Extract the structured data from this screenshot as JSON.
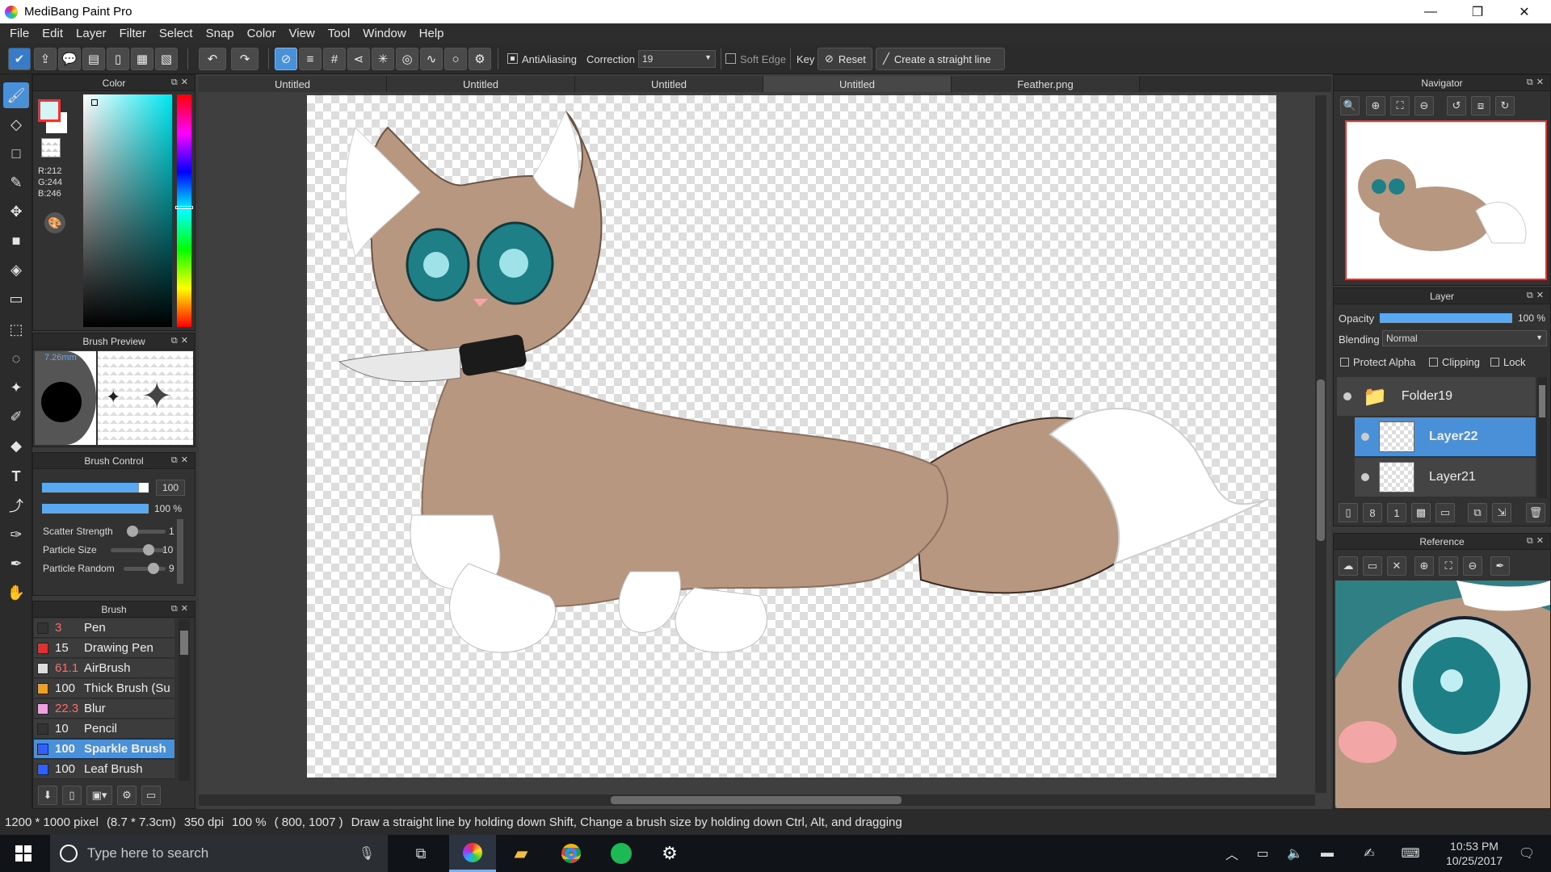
{
  "window": {
    "title": "MediBang Paint Pro",
    "controls": [
      "—",
      "❐",
      "✕"
    ]
  },
  "menu": [
    "File",
    "Edit",
    "Layer",
    "Filter",
    "Select",
    "Snap",
    "Color",
    "View",
    "Tool",
    "Window",
    "Help"
  ],
  "toolbar": {
    "antialiasing_label": "AntiAliasing",
    "correction_label": "Correction",
    "correction_value": "19",
    "softedge_label": "Soft Edge",
    "key_label": "Key",
    "reset_label": "Reset",
    "straight_line_label": "Create a straight line"
  },
  "color_panel": {
    "title": "Color",
    "r": "R:212",
    "g": "G:244",
    "b": "B:246",
    "fg_color": "#d4f4f6"
  },
  "brush_preview": {
    "title": "Brush Preview",
    "size_label": "7.26mm"
  },
  "brush_control": {
    "title": "Brush Control",
    "size_value": "100",
    "opacity_value": "100 %",
    "scatter_label": "Scatter Strength",
    "scatter_value": "1",
    "particle_size_label": "Particle Size",
    "particle_size_value": "10",
    "particle_random_label": "Particle Random",
    "particle_random_value": "9"
  },
  "brush_panel": {
    "title": "Brush",
    "items": [
      {
        "size": "3",
        "name": "Pen",
        "color": "#333333",
        "red": true
      },
      {
        "size": "15",
        "name": "Drawing Pen",
        "color": "#e53030",
        "red": false
      },
      {
        "size": "61.1",
        "name": "AirBrush",
        "color": "#dddddd",
        "red": true
      },
      {
        "size": "100",
        "name": "Thick Brush (Su",
        "color": "#f0a020",
        "red": false
      },
      {
        "size": "22.3",
        "name": "Blur",
        "color": "#f0a0e0",
        "red": true
      },
      {
        "size": "10",
        "name": "Pencil",
        "color": "#333333",
        "red": false
      },
      {
        "size": "100",
        "name": "Sparkle Brush",
        "color": "#3060ff",
        "red": false
      },
      {
        "size": "100",
        "name": "Leaf Brush",
        "color": "#3060ff",
        "red": false
      }
    ]
  },
  "tabs": [
    "Untitled",
    "Untitled",
    "Untitled",
    "Untitled",
    "Feather.png"
  ],
  "navigator": {
    "title": "Navigator"
  },
  "layer_panel": {
    "title": "Layer",
    "opacity_label": "Opacity",
    "opacity_value": "100 %",
    "blending_label": "Blending",
    "blending_value": "Normal",
    "protect_alpha": "Protect Alpha",
    "clipping": "Clipping",
    "lock": "Lock",
    "layers": [
      "Folder19",
      "Layer22",
      "Layer21"
    ]
  },
  "reference": {
    "title": "Reference"
  },
  "status": {
    "dimensions": "1200 * 1000 pixel",
    "size_cm": "(8.7 * 7.3cm)",
    "dpi": "350 dpi",
    "zoom": "100 %",
    "coords": "( 800, 1007 )",
    "hint": "Draw a straight line by holding down Shift, Change a brush size by holding down Ctrl, Alt, and dragging"
  },
  "taskbar": {
    "search_placeholder": "Type here to search",
    "time": "10:53 PM",
    "date": "10/25/2017"
  }
}
